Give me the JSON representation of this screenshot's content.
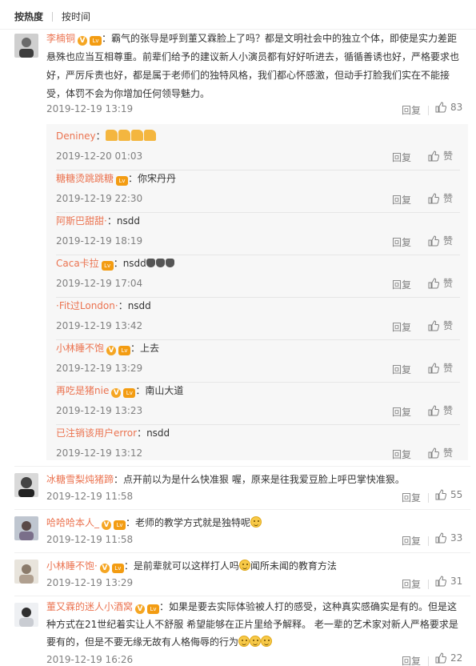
{
  "sort": {
    "hot": "按热度",
    "time": "按时间"
  },
  "comments": [
    {
      "user": "李楠铜",
      "lv": "Lv",
      "text_lines": [
        "霸气的张导是呼到董又霖脸上了吗？都是文明社会中的独立个体，即使是实力差距",
        "悬殊也应当互相尊重。前辈们给予的建议新人小演员都有好好听进去，循循善诱也好，严格要求也",
        "好，严厉斥责也好，都是属于老师们的独特风格，我们都心怀感激，但动手打脸我们实在不能接",
        "受，体罚不会为你增加任何领导魅力。"
      ],
      "time": "2019-12-19 13:19",
      "reply": "回复",
      "likes": "83"
    },
    {
      "user": "冰糖雪梨炖猪蹄",
      "text": "点开前以为是什么快准狠 喔，原来是往我爱豆脸上呼巴掌快准狠。",
      "time": "2019-12-19 11:58",
      "reply": "回复",
      "likes": "55"
    },
    {
      "user": "哈哈哈本人_",
      "lv": "Lv",
      "text": "老师的教学方式就是独特呢",
      "time": "2019-12-19 11:58",
      "reply": "回复",
      "likes": "33"
    },
    {
      "user": "小林睡不饱·",
      "lv": "Lv",
      "text_a": "是前辈就可以这样打人吗",
      "text_b": "闻所未闻的教育方法",
      "time": "2019-12-19 13:29",
      "reply": "回复",
      "likes": "31"
    },
    {
      "user": "董又霖的迷人小酒窝",
      "lv": "Lv",
      "text_lines": [
        "如果是要去实际体验被人打的感受，这种真实感确实是有的。但是这",
        "种方式在21世纪着实让人不舒服 希望能够在正片里给予解释。 老一辈的艺术家对新人严格要求是",
        "要有的，但是不要无缘无故有人格侮辱的行为"
      ],
      "time": "2019-12-19 16:26",
      "reply": "回复",
      "likes": "22"
    }
  ],
  "replies": [
    {
      "user": "Deniney",
      "text": "",
      "time": "2019-12-20 01:03",
      "reply": "回复",
      "like": "赞"
    },
    {
      "user": "糖糖烫跳跳糖",
      "lv": "Lv",
      "text": "你宋丹丹",
      "time": "2019-12-19 22:30",
      "reply": "回复",
      "like": "赞"
    },
    {
      "user": "阿斯巴甜甜·",
      "text": "nsdd",
      "time": "2019-12-19 18:19",
      "reply": "回复",
      "like": "赞"
    },
    {
      "user": "Caca卡拉",
      "lv": "Lv",
      "text": "nsdd",
      "time": "2019-12-19 17:04",
      "reply": "回复",
      "like": "赞"
    },
    {
      "user": "·Fit过London·",
      "text": "nsdd",
      "time": "2019-12-19 13:42",
      "reply": "回复",
      "like": "赞"
    },
    {
      "user": "小林睡不饱",
      "lv": "Lv",
      "text": "上去",
      "time": "2019-12-19 13:29",
      "reply": "回复",
      "like": "赞"
    },
    {
      "user": "再吃是猪nie",
      "lv": "Lv",
      "text": "南山大道",
      "time": "2019-12-19 13:23",
      "reply": "回复",
      "like": "赞"
    },
    {
      "user": "已注销该用户error",
      "text": "nsdd",
      "time": "2019-12-19 13:12",
      "reply": "回复",
      "like": "赞"
    }
  ],
  "colors": {
    "username": "#eb7350",
    "meta": "#808080",
    "reply_bg": "#f7f7f7"
  },
  "icons": [
    "like-icon",
    "verified-v-icon",
    "level-badge-icon",
    "smile-emoji-icon",
    "thumbs-up-emoji-icon",
    "clap-emoji-icon"
  ]
}
